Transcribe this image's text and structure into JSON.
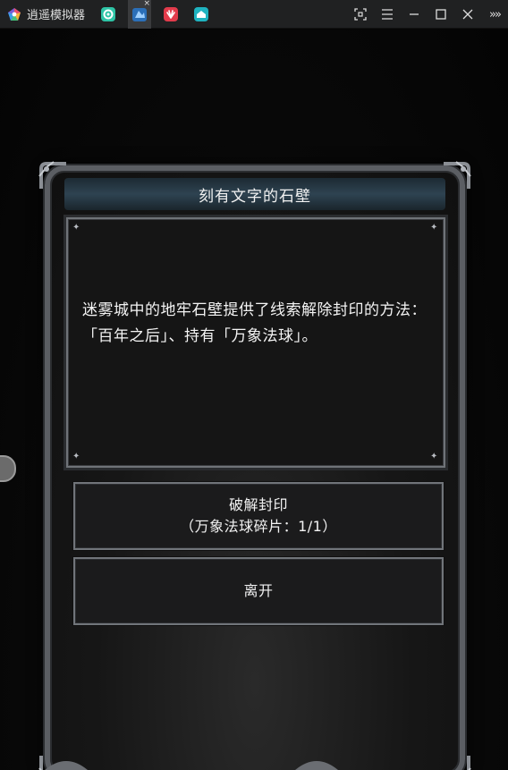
{
  "titlebar": {
    "app_title": "逍遥模拟器",
    "tabs": [
      {
        "name": "tab-app-green",
        "color": "#2ec4a6"
      },
      {
        "name": "tab-game-active",
        "color": "#2b6fb8",
        "close": "×"
      },
      {
        "name": "tab-huawei",
        "color": "#e23b4b"
      },
      {
        "name": "tab-home",
        "color": "#1fb3c0"
      }
    ],
    "more_label": "»»"
  },
  "dialog": {
    "title": "刻有文字的石壁",
    "message": "迷雾城中的地牢石壁提供了线索解除封印的方法：「百年之后」、持有「万象法球」。",
    "choices": [
      {
        "line1": "破解封印",
        "line2": "（万象法球碎片：1/1）"
      },
      {
        "line1": "离开"
      }
    ]
  },
  "colors": {
    "titlebar_bg": "#202122",
    "frame": "#5b5e63",
    "title_band": "#2e4351"
  }
}
